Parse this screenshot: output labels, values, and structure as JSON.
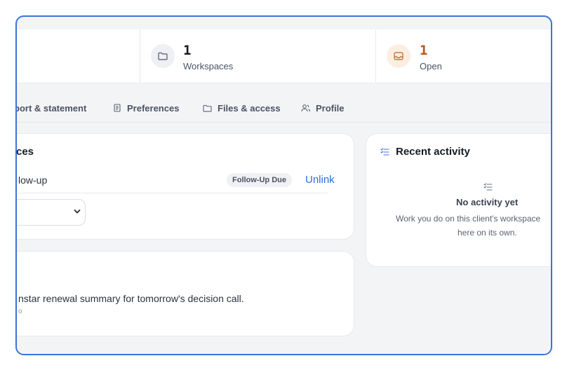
{
  "stats": [
    {
      "value": "1",
      "label": "Workspaces",
      "icon": "folder-icon",
      "value_color": "#161b26"
    },
    {
      "value": "1",
      "label": "Open",
      "icon": "inbox-icon",
      "value_color": "#b4581a"
    }
  ],
  "tabs": [
    {
      "label": "port & statement"
    },
    {
      "label": "Preferences",
      "icon": "document-icon"
    },
    {
      "label": "Files & access",
      "icon": "folder-icon"
    },
    {
      "label": "Profile",
      "icon": "users-icon"
    }
  ],
  "workspaces_card": {
    "title": "ces",
    "row_text": "low-up",
    "badge": "Follow-Up Due",
    "unlink_label": "Unlink"
  },
  "note_card": {
    "text": "nstar renewal summary for tomorrow's decision call.",
    "meta": "o"
  },
  "activity_card": {
    "title": "Recent activity",
    "empty_title": "No activity yet",
    "empty_text_line1": "Work you do on this client's workspace",
    "empty_text_line2": "here on its own."
  },
  "colors": {
    "accent": "#3b73d9",
    "link": "#2f6fd6",
    "orange": "#b4581a"
  }
}
